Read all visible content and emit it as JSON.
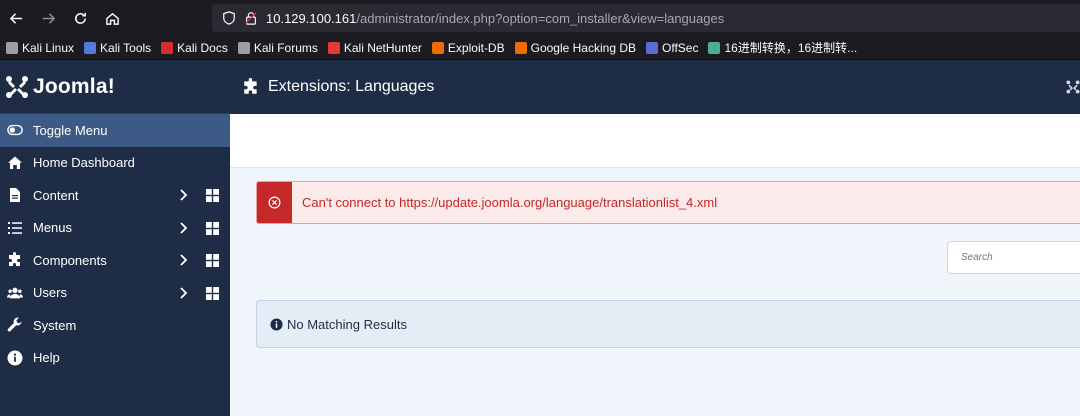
{
  "browser": {
    "url_host": "10.129.100.161",
    "url_path": "/administrator/index.php?option=com_installer&view=languages",
    "bookmarks": [
      {
        "label": "Kali Linux",
        "icon": "kali-dragon-icon",
        "color": "#9aa0a6"
      },
      {
        "label": "Kali Tools",
        "icon": "kali-tools-icon",
        "color": "#4f7bd9"
      },
      {
        "label": "Kali Docs",
        "icon": "kali-docs-icon",
        "color": "#d32f2f"
      },
      {
        "label": "Kali Forums",
        "icon": "kali-dragon-icon",
        "color": "#9aa0a6"
      },
      {
        "label": "Kali NetHunter",
        "icon": "nethunter-icon",
        "color": "#e53935"
      },
      {
        "label": "Exploit-DB",
        "icon": "exploit-db-icon",
        "color": "#ef6c00"
      },
      {
        "label": "Google Hacking DB",
        "icon": "ghdb-icon",
        "color": "#ef6c00"
      },
      {
        "label": "OffSec",
        "icon": "offsec-icon",
        "color": "#5b6bd6"
      },
      {
        "label": "16进制转换，16进制转...",
        "icon": "gear-icon",
        "color": "#4caf93"
      }
    ]
  },
  "app": {
    "logo_text": "Joomla!",
    "page_title": "Extensions: Languages",
    "accent_color": "#1e2d45"
  },
  "sidebar": {
    "items": [
      {
        "label": "Toggle Menu",
        "icon": "toggle-icon",
        "active": true
      },
      {
        "label": "Home Dashboard",
        "icon": "home-icon"
      },
      {
        "label": "Content",
        "icon": "file-icon",
        "submenu": true
      },
      {
        "label": "Menus",
        "icon": "list-icon",
        "submenu": true
      },
      {
        "label": "Components",
        "icon": "puzzle-icon",
        "submenu": true
      },
      {
        "label": "Users",
        "icon": "users-icon",
        "submenu": true
      },
      {
        "label": "System",
        "icon": "wrench-icon"
      },
      {
        "label": "Help",
        "icon": "info-icon"
      }
    ]
  },
  "alert": {
    "message": "Can't connect to https://update.joomla.org/language/translationlist_4.xml",
    "color": "#c52828"
  },
  "search": {
    "placeholder": "Search"
  },
  "info": {
    "message": "No Matching Results"
  }
}
